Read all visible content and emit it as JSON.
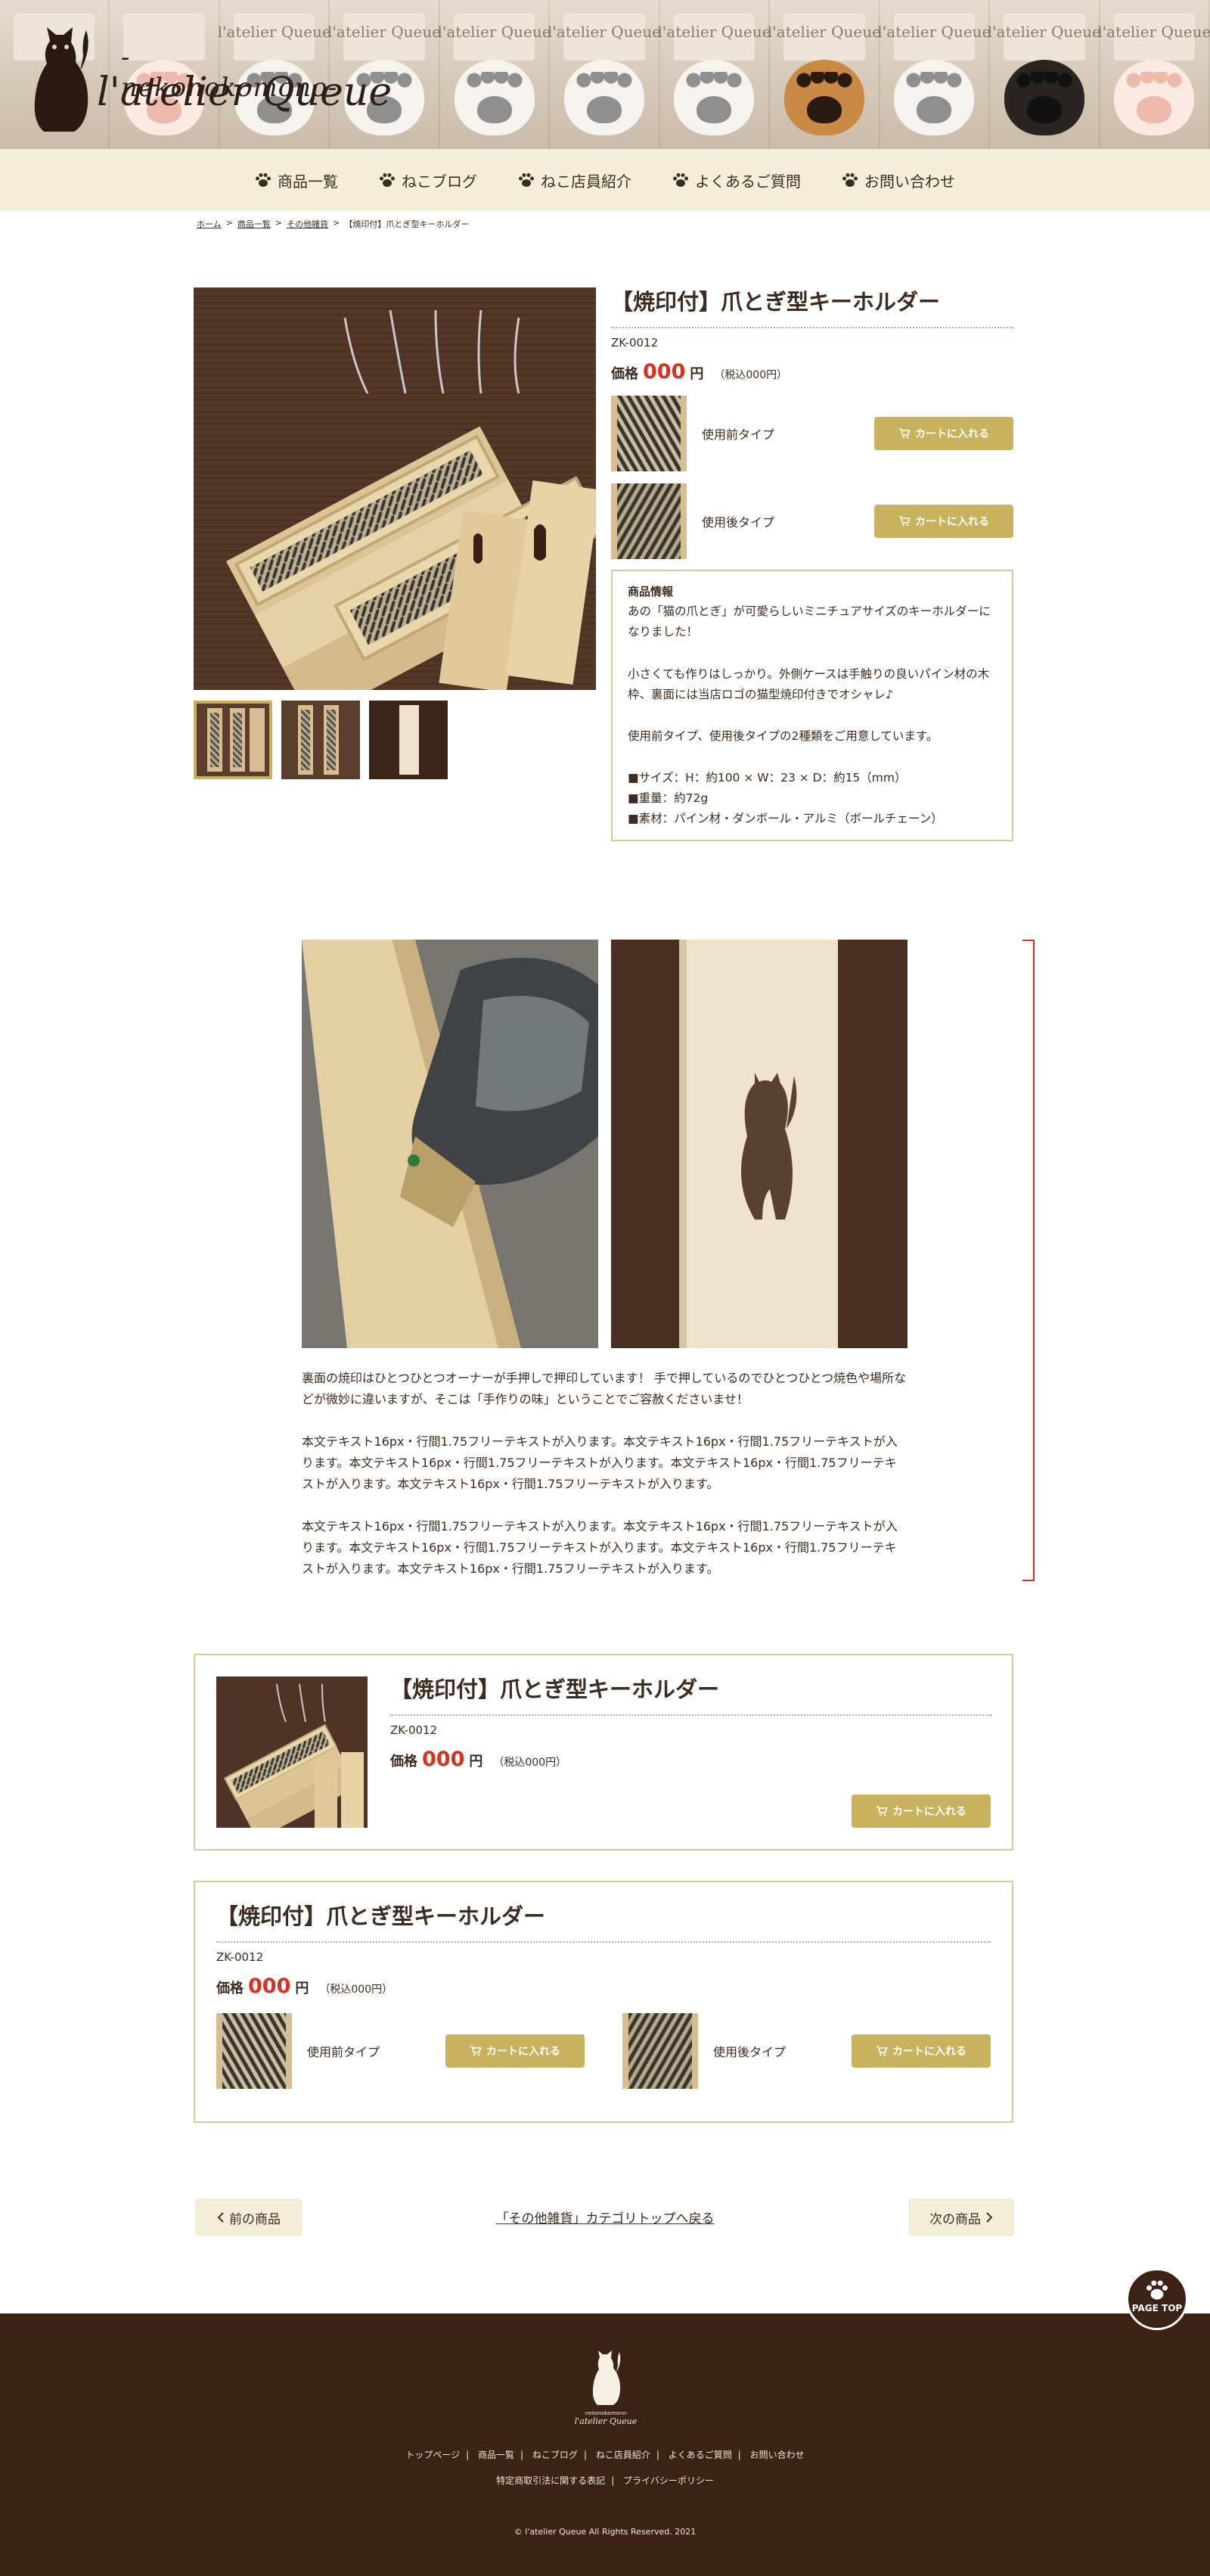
{
  "site": {
    "logo_sub": "-nekonokomono-",
    "logo_main": "l'atelier Queue",
    "hero_tag_text": "l'atelier Queue"
  },
  "nav": {
    "items": [
      {
        "label": "商品一覧"
      },
      {
        "label": "ねこブログ"
      },
      {
        "label": "ねこ店員紹介"
      },
      {
        "label": "よくあるご質問"
      },
      {
        "label": "お問い合わせ"
      }
    ]
  },
  "breadcrumb": {
    "items": [
      "ホーム",
      "商品一覧",
      "その他雑貨",
      "【焼印付】爪とぎ型キーホルダー"
    ],
    "separator": ">"
  },
  "product": {
    "title": "【焼印付】爪とぎ型キーホルダー",
    "code": "ZK-0012",
    "price_label": "価格",
    "price": "000",
    "price_unit": "円",
    "price_tax": "（税込000円）",
    "variants": [
      {
        "label": "使用前タイプ",
        "button": "カートに入れる"
      },
      {
        "label": "使用後タイプ",
        "button": "カートに入れる"
      }
    ],
    "spec": {
      "title": "商品情報",
      "p1": "あの「猫の爪とぎ」が可愛らしいミニチュアサイズのキーホルダーになりました！",
      "p2": "小さくても作りはしっかり。外側ケースは手触りの良いパイン材の木枠、裏面には当店ロゴの猫型焼印付きでオシャレ♪",
      "p3": "使用前タイプ、使用後タイプの2種類をご用意しています。",
      "p4": "■サイズ：H：約100 × W：23 × D：約15（mm）\n■重量：約72g\n■素材：パイン材・ダンボール・アルミ（ボールチェーン）"
    }
  },
  "body": {
    "p1": "裏面の焼印はひとつひとつオーナーが手押しで押印しています！ 手で押しているのでひとつひとつ焼色や場所などが微妙に違いますが、そこは「手作りの味」ということでご容赦くださいませ！",
    "p2": "本文テキスト16px・行間1.75フリーテキストが入ります。本文テキスト16px・行間1.75フリーテキストが入ります。本文テキスト16px・行間1.75フリーテキストが入ります。本文テキスト16px・行間1.75フリーテキストが入ります。本文テキスト16px・行間1.75フリーテキストが入ります。",
    "p3": "本文テキスト16px・行間1.75フリーテキストが入ります。本文テキスト16px・行間1.75フリーテキストが入ります。本文テキスト16px・行間1.75フリーテキストが入ります。本文テキスト16px・行間1.75フリーテキストが入ります。本文テキスト16px・行間1.75フリーテキストが入ります。"
  },
  "card1": {
    "title": "【焼印付】爪とぎ型キーホルダー",
    "code": "ZK-0012",
    "price_label": "価格",
    "price": "000",
    "price_unit": "円",
    "price_tax": "（税込000円）",
    "button": "カートに入れる"
  },
  "card2": {
    "title": "【焼印付】爪とぎ型キーホルダー",
    "code": "ZK-0012",
    "price_label": "価格",
    "price": "000",
    "price_unit": "円",
    "price_tax": "（税込000円）",
    "variants": [
      {
        "label": "使用前タイプ",
        "button": "カートに入れる"
      },
      {
        "label": "使用後タイプ",
        "button": "カートに入れる"
      }
    ]
  },
  "pager": {
    "prev": "前の商品",
    "category": "「その他雑貨」カテゴリトップへ戻る",
    "next": "次の商品"
  },
  "pagetop": {
    "label": "PAGE TOP"
  },
  "footer": {
    "logo_sub": "-nekonokomono-",
    "logo_main": "l'atelier Queue",
    "links": [
      "トップページ",
      "商品一覧",
      "ねこブログ",
      "ねこ店員紹介",
      "よくあるご質問",
      "お問い合わせ"
    ],
    "links2": [
      "特定商取引法に関する表記",
      "プライバシーポリシー"
    ],
    "separator": "|",
    "copyright": "© l'atelier Queue All Rights Reserved. 2021"
  },
  "colors": {
    "accent": "#c9b25d",
    "price": "#d9311f",
    "nav_bg": "#f4eed9",
    "footer_bg": "#3b2214",
    "text": "#3d2b1f"
  },
  "icons": {
    "nav": "paw-icon",
    "cart": "cart-icon",
    "prev": "chevron-left-icon",
    "next": "chevron-right-icon"
  }
}
